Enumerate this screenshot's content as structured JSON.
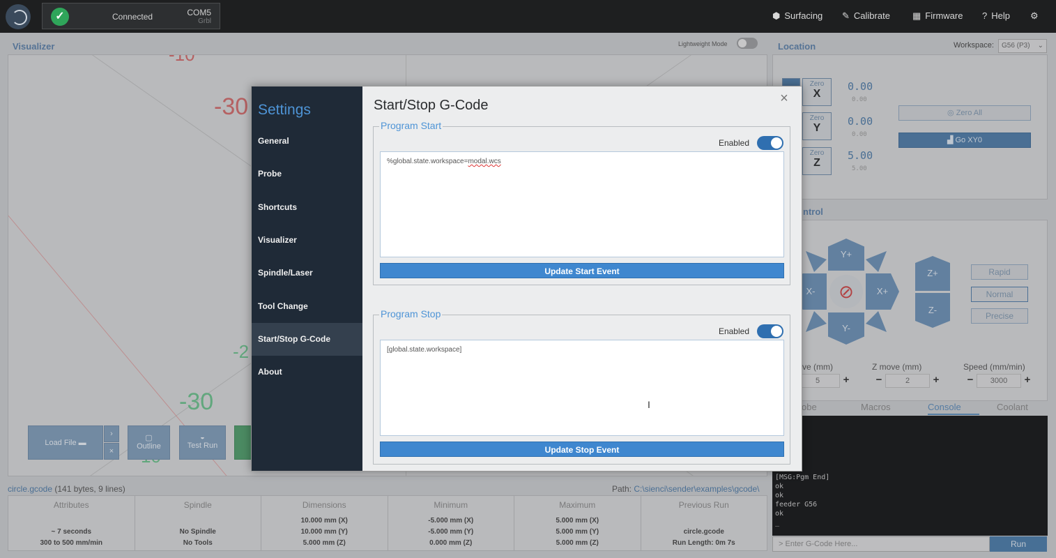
{
  "topbar": {
    "connection": {
      "status": "Connected",
      "port": "COM5",
      "firmware": "Grbl"
    },
    "nav": [
      {
        "label": "Surfacing",
        "icon": "surfacing-icon"
      },
      {
        "label": "Calibrate",
        "icon": "calibrate-icon"
      },
      {
        "label": "Firmware",
        "icon": "firmware-icon"
      },
      {
        "label": "Help",
        "icon": "help-icon"
      }
    ]
  },
  "visualizer": {
    "title": "Visualizer",
    "lightweight_label": "Lightweight Mode",
    "axis_labels": [
      "-30",
      "-30",
      "-2",
      "-10",
      "10"
    ],
    "buttons": {
      "load_file": "Load File",
      "outline": "Outline",
      "test_run": "Test Run"
    }
  },
  "location": {
    "title": "Location",
    "workspace_label": "Workspace:",
    "workspace_value": "G56 (P3)",
    "zero_label": "Zero",
    "axes": [
      {
        "axis": "X",
        "value": "0.00",
        "machine": "0.00"
      },
      {
        "axis": "Y",
        "value": "0.00",
        "machine": "0.00"
      },
      {
        "axis": "Z",
        "value": "5.00",
        "machine": "5.00"
      }
    ],
    "zero_all": "Zero All",
    "go_xy0": "Go XY0"
  },
  "control": {
    "title": "ntrol",
    "jog": {
      "yplus": "Y+",
      "yminus": "Y-",
      "xplus": "X+",
      "xminus": "X-",
      "zplus": "Z+",
      "zminus": "Z-"
    },
    "speeds": [
      "Rapid",
      "Normal",
      "Precise"
    ],
    "xy_move_label": "ve (mm)",
    "z_move_label": "Z move (mm)",
    "speed_label": "Speed (mm/min)",
    "xy_move": "5",
    "z_move": "2",
    "speed": "3000"
  },
  "tabs": [
    "obe",
    "Macros",
    "Console",
    "Coolant"
  ],
  "console": {
    "lines": [
      "[MSG:Pgm End]",
      "ok",
      "ok",
      "feeder G56",
      "ok",
      "_"
    ],
    "placeholder": "Enter G-Code Here...",
    "run": "Run"
  },
  "file": {
    "name": "circle.gcode",
    "meta": "(141 bytes, 9 lines)",
    "path_label": "Path:",
    "path": "C:\\sienci\\sender\\examples\\gcode\\"
  },
  "stats": [
    {
      "head": "Attributes",
      "lines": [
        "~ 7 seconds",
        "300 to 500 mm/min"
      ]
    },
    {
      "head": "Spindle",
      "lines": [
        "No Spindle",
        "No Tools"
      ]
    },
    {
      "head": "Dimensions",
      "lines": [
        "10.000 mm (X)",
        "10.000 mm (Y)",
        "5.000 mm (Z)"
      ]
    },
    {
      "head": "Minimum",
      "lines": [
        "-5.000 mm (X)",
        "-5.000 mm (Y)",
        "0.000 mm (Z)"
      ]
    },
    {
      "head": "Maximum",
      "lines": [
        "5.000 mm (X)",
        "5.000 mm (Y)",
        "5.000 mm (Z)"
      ]
    },
    {
      "head": "Previous Run",
      "lines": [
        "circle.gcode",
        "Run Length: 0m 7s"
      ]
    }
  ],
  "settings": {
    "title": "Settings",
    "items": [
      "General",
      "Probe",
      "Shortcuts",
      "Visualizer",
      "Spindle/Laser",
      "Tool Change",
      "Start/Stop G-Code",
      "About"
    ],
    "active_index": 6,
    "content_title": "Start/Stop G-Code",
    "start": {
      "legend": "Program Start",
      "enabled_label": "Enabled",
      "code_prefix": "%global.state.workspace=",
      "code_flagged": "modal.wcs",
      "button": "Update Start Event"
    },
    "stop": {
      "legend": "Program Stop",
      "enabled_label": "Enabled",
      "code": "[global.state.workspace]",
      "button": "Update Stop Event"
    }
  }
}
